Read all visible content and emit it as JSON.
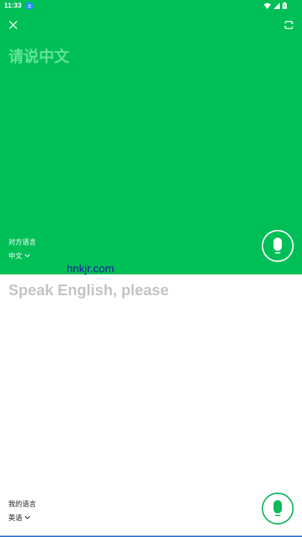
{
  "status_bar": {
    "time": "11:33",
    "badge": "±"
  },
  "top_panel": {
    "prompt": "请说中文",
    "language_caption": "对方语言",
    "language_value": "中文"
  },
  "watermark": "hnkjr.com",
  "bottom_panel": {
    "prompt": "Speak English, please",
    "language_caption": "我的语言",
    "language_value": "英语"
  },
  "colors": {
    "accent_green": "#00bf56",
    "mic_ring_green": "#10b95a",
    "prompt_gray": "#c4c4c4"
  },
  "icons": [
    "close-icon",
    "flip-screen-icon",
    "microphone-icon",
    "chevron-down-icon",
    "wifi-icon",
    "signal-icon",
    "battery-icon"
  ]
}
